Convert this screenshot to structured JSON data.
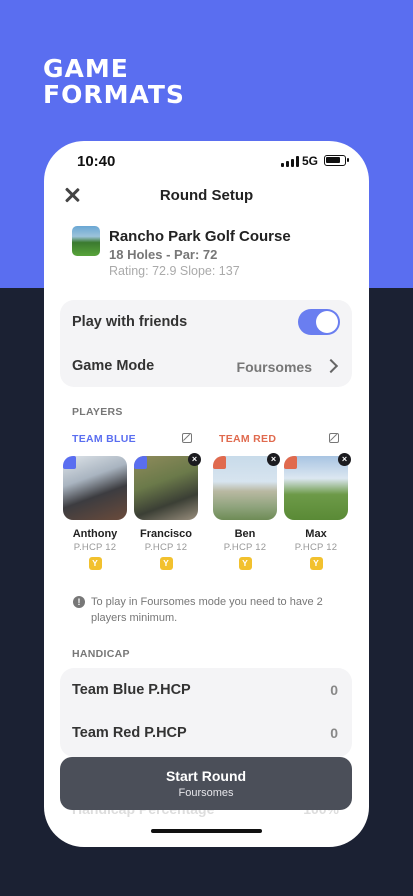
{
  "promo": {
    "headline_line1": "GAME",
    "headline_line2": "FORMATS"
  },
  "status_bar": {
    "time": "10:40",
    "network": "5G"
  },
  "nav": {
    "title": "Round Setup"
  },
  "course": {
    "name": "Rancho Park Golf Course",
    "holes_par": "18 Holes - Par: 72",
    "rating_slope": "Rating: 72.9  Slope: 137"
  },
  "setup": {
    "play_with_friends_label": "Play with friends",
    "play_with_friends_on": true,
    "game_mode_label": "Game Mode",
    "game_mode_value": "Foursomes"
  },
  "players_section": {
    "header": "PLAYERS",
    "team_blue": "TEAM BLUE",
    "team_red": "TEAM RED",
    "players": [
      {
        "name": "Anthony",
        "phcp": "P.HCP 12",
        "tee": "Y"
      },
      {
        "name": "Francisco",
        "phcp": "P.HCP 12",
        "tee": "Y"
      },
      {
        "name": "Ben",
        "phcp": "P.HCP 12",
        "tee": "Y"
      },
      {
        "name": "Max",
        "phcp": "P.HCP 12",
        "tee": "Y"
      }
    ],
    "info_icon": "!",
    "remove_icon": "×",
    "info_text": "To play in Foursomes mode you need to have 2 players minimum."
  },
  "handicap_section": {
    "header": "HANDICAP",
    "rows": [
      {
        "label": "Team Blue P.HCP",
        "value": "0"
      },
      {
        "label": "Team Red P.HCP",
        "value": "0"
      }
    ],
    "peek_label": "Handicap Percentage",
    "peek_value": "100%"
  },
  "cta": {
    "title": "Start Round",
    "subtitle": "Foursomes"
  },
  "colors": {
    "promo_bg": "#5a6ef0",
    "dark_bg": "#1b2133",
    "team_blue": "#5a6ef0",
    "team_red": "#e06a4e",
    "toggle_on": "#6a7ef0",
    "tee_yellow": "#f2c12e"
  }
}
